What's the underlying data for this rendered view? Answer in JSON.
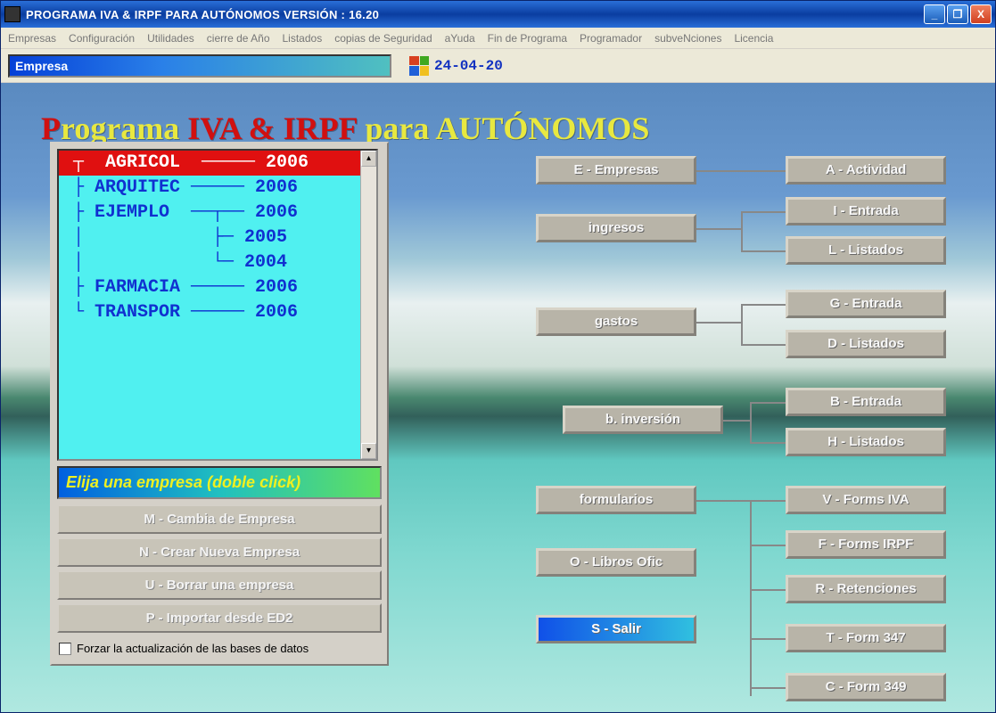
{
  "title": "PROGRAMA IVA & IRPF PARA AUTÓNOMOS  VERSIÓN : 16.20",
  "menu": [
    "Empresas",
    "Configuración",
    "Utilidades",
    "cierre de Año",
    "Listados",
    "copias de Seguridad",
    "aYuda",
    "Fin de Programa",
    "Programador",
    "subveNciones",
    "Licencia"
  ],
  "empresa_label": "Empresa",
  "date": "24-04-20",
  "bg_title_red1": "P",
  "bg_title_yellow1": "rograma ",
  "bg_title_red2": "IVA  & IRPF ",
  "bg_title_yellow2": "para AUTÓNOMOS",
  "list": {
    "rows": [
      " ┬  AGRICOL  ───── 2006",
      " ├ ARQUITEC ───── 2006",
      " ├ EJEMPLO  ──┬── 2006",
      " │            ├─ 2005",
      " │            └─ 2004",
      " ├ FARMACIA ───── 2006",
      " └ TRANSPOR ───── 2006"
    ],
    "selected_index": 0
  },
  "instruction": "Elija una empresa (doble click)",
  "panel_buttons": {
    "m": "M - Cambia de Empresa",
    "n": "N - Crear Nueva Empresa",
    "u": "U - Borrar una empresa",
    "p": "P - Importar desde ED2"
  },
  "checkbox_label": "Forzar la actualización de las bases de datos",
  "right": {
    "empresas": "E - Empresas",
    "actividad": "A - Actividad",
    "ingresos": "ingresos",
    "i_entrada": "I - Entrada",
    "l_listados": "L - Listados",
    "gastos": "gastos",
    "g_entrada": "G - Entrada",
    "d_listados": "D - Listados",
    "binversion": "b. inversión",
    "b_entrada": "B - Entrada",
    "h_listados": "H - Listados",
    "formularios": "formularios",
    "v_iva": "V - Forms  IVA",
    "f_irpf": "F - Forms IRPF",
    "libros": "O - Libros Ofic",
    "r_ret": "R - Retenciones",
    "salir": "S - Salir",
    "t_347": "T - Form  347",
    "c_349": "C - Form  349"
  }
}
